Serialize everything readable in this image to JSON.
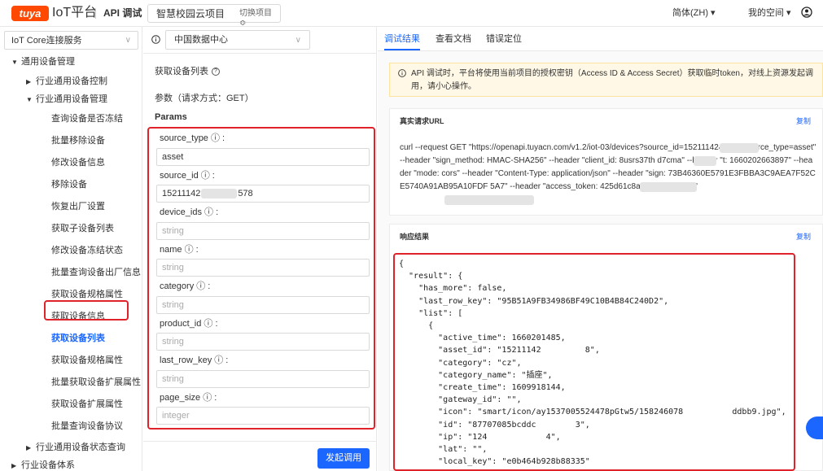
{
  "header": {
    "logo_text": "tuya",
    "platform": "IoT平台",
    "api_debug": "API 调试",
    "project_name": "智慧校园云项目",
    "switch_project": "切换项目 ≎",
    "language": "简体(ZH) ▾",
    "my_space": "我的空间 ▾",
    "user_icon": "user-circle-icon"
  },
  "sidebar": {
    "service_select": "IoT Core连接服务",
    "items": [
      {
        "label": "通用设备管理",
        "expanded": true
      },
      {
        "label": "行业通用设备控制",
        "expanded": false
      },
      {
        "label": "行业通用设备管理",
        "expanded": true
      },
      {
        "label": "行业通用设备状态查询",
        "expanded": false
      },
      {
        "label": "行业设备体系",
        "expanded": false
      }
    ],
    "leaves": [
      "查询设备是否冻结",
      "批量移除设备",
      "修改设备信息",
      "移除设备",
      "恢复出厂设置",
      "获取子设备列表",
      "修改设备冻结状态",
      "批量查询设备出厂信息",
      "获取设备规格属性",
      "获取设备信息",
      "获取设备列表",
      "获取设备规格属性",
      "批量获取设备扩展属性",
      "获取设备扩展属性",
      "批量查询设备协议"
    ],
    "active_leaf": "获取设备列表"
  },
  "request": {
    "region": "中国数据中心",
    "title": "获取设备列表",
    "method_text": "参数（请求方式：GET）",
    "params_heading": "Params",
    "params": [
      {
        "name": "source_type",
        "label": "source_type ⓘ :",
        "value": "asset",
        "placeholder": ""
      },
      {
        "name": "source_id",
        "label": "source_id ⓘ :",
        "value": "15211142",
        "value_tail": "578",
        "placeholder": ""
      },
      {
        "name": "device_ids",
        "label": "device_ids ⓘ :",
        "value": "",
        "placeholder": "string"
      },
      {
        "name": "name",
        "label": "name ⓘ :",
        "value": "",
        "placeholder": "string"
      },
      {
        "name": "category",
        "label": "category ⓘ :",
        "value": "",
        "placeholder": "string"
      },
      {
        "name": "product_id",
        "label": "product_id ⓘ :",
        "value": "",
        "placeholder": "string"
      },
      {
        "name": "last_row_key",
        "label": "last_row_key ⓘ :",
        "value": "",
        "placeholder": "string"
      },
      {
        "name": "page_size",
        "label": "page_size ⓘ :",
        "value": "",
        "placeholder": "integer"
      }
    ],
    "submit_label": "发起调用"
  },
  "result": {
    "tabs": [
      "调试结果",
      "查看文档",
      "错误定位"
    ],
    "active_tab": "调试结果",
    "alert": "API 调试时，平台将使用当前项目的授权密钥（Access ID & Access Secret）获取临时token，对线上资源发起调用，请小心操作。",
    "request_url_title": "真实请求URL",
    "copy_label": "复制",
    "curl": "curl --request GET \"https://openapi.tuyacn.com/v1.2/iot-03/devices?source_id=152111424          578&source_type=asset\" --header \"sign_method: HMAC-SHA256\" --header \"client_id: 8usrs37th          d7cma\" --header \"t: 1660202663897\" --header \"mode: cors\" --header \"Content-Type: application/json\" --header \"sign: 73B46360E5791E3FBBA3C9AEA7F52CE5740A91AB95A10FDF                    5A7\" --header \"access_token: 425d61c8afe7978b                  d5e47\"",
    "response_title": "响应结果",
    "response_json": "{\n  \"result\": {\n    \"has_more\": false,\n    \"last_row_key\": \"95B51A9FB34986BF49C10B4B84C240D2\",\n    \"list\": [\n      {\n        \"active_time\": 1660201485,\n        \"asset_id\": \"15211142         8\",\n        \"category\": \"cz\",\n        \"category_name\": \"插座\",\n        \"create_time\": 1609918144,\n        \"gateway_id\": \"\",\n        \"icon\": \"smart/icon/ay1537005524478pGtw5/158246078          ddbb9.jpg\",\n        \"id\": \"87707085bcddc        3\",\n        \"ip\": \"124            4\",\n        \"lat\": \"\",\n        \"local_key\": \"e0b464b928b88335\""
  }
}
